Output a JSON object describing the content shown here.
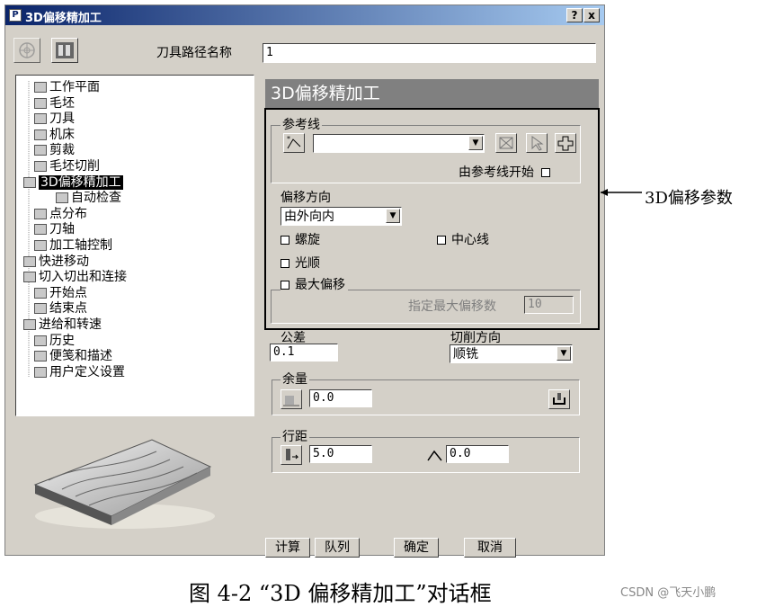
{
  "window": {
    "title": "3D偏移精加工",
    "help_label": "?",
    "close_label": "x"
  },
  "header": {
    "path_name_label": "刀具路径名称",
    "path_name_value": "1"
  },
  "tree": {
    "items": [
      {
        "label": "工作平面",
        "selected": false
      },
      {
        "label": "毛坯",
        "selected": false
      },
      {
        "label": "刀具",
        "selected": false
      },
      {
        "label": "机床",
        "selected": false
      },
      {
        "label": "剪裁",
        "selected": false
      },
      {
        "label": "毛坯切削",
        "selected": false
      },
      {
        "label": "3D偏移精加工",
        "selected": true
      },
      {
        "label": "自动检查",
        "selected": false
      },
      {
        "label": "点分布",
        "selected": false
      },
      {
        "label": "刀轴",
        "selected": false
      },
      {
        "label": "加工轴控制",
        "selected": false
      },
      {
        "label": "快进移动",
        "selected": false
      },
      {
        "label": "切入切出和连接",
        "selected": false
      },
      {
        "label": "开始点",
        "selected": false
      },
      {
        "label": "结束点",
        "selected": false
      },
      {
        "label": "进给和转速",
        "selected": false
      },
      {
        "label": "历史",
        "selected": false
      },
      {
        "label": "便笺和描述",
        "selected": false
      },
      {
        "label": "用户定义设置",
        "selected": false
      }
    ]
  },
  "panel": {
    "title": "3D偏移精加工",
    "reference": {
      "group_label": "参考线",
      "select_value": "",
      "start_from_label": "由参考线开始"
    },
    "offset": {
      "direction_label": "偏移方向",
      "direction_value": "由外向内",
      "spiral_label": "螺旋",
      "centerline_label": "中心线",
      "smooth_label": "光顺",
      "max_offset_label": "最大偏移",
      "max_offset_count_label": "指定最大偏移数",
      "max_offset_count_value": "10"
    },
    "tolerance": {
      "label": "公差",
      "value": "0.1"
    },
    "cut_direction": {
      "label": "切削方向",
      "value": "顺铣"
    },
    "allowance": {
      "group_label": "余量",
      "value": "0.0"
    },
    "stepover": {
      "group_label": "行距",
      "value": "5.0",
      "second_value": "0.0"
    }
  },
  "buttons": {
    "calculate": "计算",
    "queue": "队列",
    "ok": "确定",
    "cancel": "取消"
  },
  "annotation": {
    "label": "3D偏移参数"
  },
  "caption": "图 4-2  “3D 偏移精加工”对话框",
  "watermark": "CSDN @飞天小鹏"
}
